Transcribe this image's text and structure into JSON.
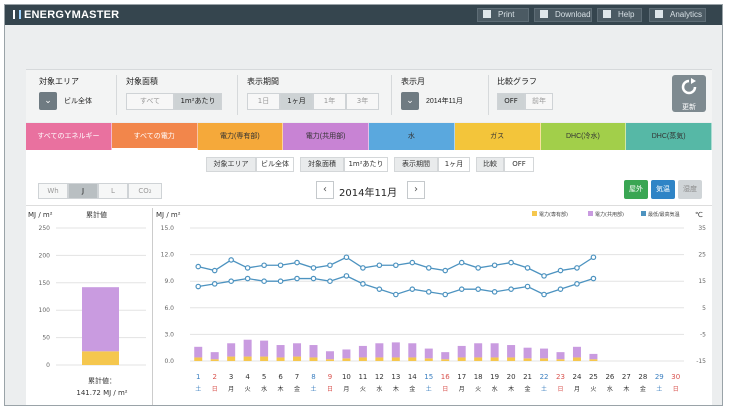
{
  "app": {
    "title": "ENERGYMASTER",
    "menu": [
      {
        "label": "Print",
        "icon": "printer-icon"
      },
      {
        "label": "Download",
        "icon": "download-icon"
      },
      {
        "label": "Help",
        "icon": "help-icon"
      },
      {
        "label": "Analytics",
        "icon": "analytics-icon"
      }
    ]
  },
  "filters": {
    "area": {
      "label": "対象エリア",
      "value": "ビル全体"
    },
    "floor": {
      "label": "対象面積",
      "options": [
        "すべて",
        "1m²あたり"
      ],
      "selected": "1m²あたり"
    },
    "period": {
      "label": "表示期間",
      "options": [
        "1日",
        "1ヶ月",
        "1年",
        "3年"
      ],
      "selected": "1ヶ月"
    },
    "month": {
      "label": "表示月",
      "value": "2014年11月"
    },
    "compare": {
      "label": "比較グラフ",
      "options": [
        "OFF",
        "前年"
      ],
      "selected": "OFF"
    },
    "refresh_label": "更新"
  },
  "tabs": [
    {
      "label": "すべてのエネルギー",
      "color": "#e9719f"
    },
    {
      "label": "すべての電力",
      "color": "#f2864b"
    },
    {
      "label": "電力(専有部)",
      "color": "#f5a93a"
    },
    {
      "label": "電力(共用部)",
      "color": "#c883d4"
    },
    {
      "label": "水",
      "color": "#5aa8de"
    },
    {
      "label": "ガス",
      "color": "#f3c53a"
    },
    {
      "label": "DHC(冷水)",
      "color": "#a2cf4a"
    },
    {
      "label": "DHC(蒸気)",
      "color": "#56b8a6"
    }
  ],
  "summary": {
    "area_key": "対象エリア",
    "area_val": "ビル全体",
    "floor_key": "対象面積",
    "floor_val": "1m²あたり",
    "period_key": "表示期間",
    "period_val": "1ヶ月",
    "compare_key": "比較",
    "compare_val": "OFF"
  },
  "units": {
    "options": [
      "Wh",
      "J",
      "L",
      "CO₂"
    ],
    "selected": "J"
  },
  "nav": {
    "month": "2014年11月",
    "prev": "‹",
    "next": "›"
  },
  "side_buttons": [
    {
      "label": "屋外",
      "color": "#3aa653"
    },
    {
      "label": "気温",
      "color": "#2f84c6"
    },
    {
      "label": "湿度",
      "color": "#d0d5d8"
    }
  ],
  "left_chart": {
    "unit": "MJ / m²",
    "title": "累計値",
    "ticks": [
      "250",
      "200",
      "150",
      "100",
      "50",
      "0"
    ],
    "total_label": "累計値：",
    "total_value": "141.72 MJ / m²"
  },
  "chart_data": {
    "type": "bar",
    "ylabel": "MJ / m²",
    "y2label": "℃",
    "ylim": [
      0,
      15
    ],
    "y2lim": [
      -15,
      35
    ],
    "ticks_left": [
      "15.0",
      "12.0",
      "9.0",
      "6.0",
      "3.0",
      "0.0"
    ],
    "ticks_right": [
      "35",
      "25",
      "15",
      "5",
      "-5",
      "-15"
    ],
    "legend": [
      "電力(専有部)",
      "電力(共用部)",
      "最低/最高気温"
    ],
    "categories": [
      "1",
      "2",
      "3",
      "4",
      "5",
      "6",
      "7",
      "8",
      "9",
      "10",
      "11",
      "12",
      "13",
      "14",
      "15",
      "16",
      "17",
      "18",
      "19",
      "20",
      "21",
      "22",
      "23",
      "24",
      "25",
      "26",
      "27",
      "28",
      "29",
      "30"
    ],
    "day_labels": [
      "土",
      "日",
      "月",
      "火",
      "水",
      "木",
      "金",
      "土",
      "日",
      "月",
      "火",
      "水",
      "木",
      "金",
      "土",
      "日",
      "月",
      "火",
      "水",
      "木",
      "金",
      "土",
      "日",
      "月",
      "火",
      "水",
      "木",
      "金",
      "土",
      "日"
    ],
    "series": [
      {
        "name": "電力(専有部)",
        "color": "#f5c74e",
        "values": [
          0.4,
          0.2,
          0.5,
          0.5,
          0.5,
          0.4,
          0.5,
          0.4,
          0.2,
          0.3,
          0.4,
          0.4,
          0.4,
          0.4,
          0.3,
          0.2,
          0.4,
          0.4,
          0.4,
          0.4,
          0.3,
          0.3,
          0.2,
          0.4,
          0.2,
          0,
          0,
          0,
          0,
          0
        ]
      },
      {
        "name": "電力(共用部)",
        "color": "#c99be0",
        "values": [
          1.2,
          0.8,
          1.5,
          1.9,
          1.8,
          1.4,
          1.5,
          1.4,
          0.9,
          1.0,
          1.3,
          1.6,
          1.7,
          1.6,
          1.1,
          0.8,
          1.3,
          1.6,
          1.6,
          1.4,
          1.2,
          1.1,
          0.8,
          1.2,
          0.6,
          0,
          0,
          0,
          0,
          0
        ]
      },
      {
        "name": "最高気温",
        "color": "#4d93c0",
        "values": [
          20.5,
          19,
          23,
          20,
          21,
          21,
          22,
          20,
          21,
          24,
          20,
          21,
          21,
          22,
          20,
          19,
          22,
          20,
          21,
          22,
          20,
          17,
          19,
          20,
          24
        ]
      },
      {
        "name": "最低気温",
        "color": "#4d93c0",
        "values": [
          13,
          14,
          15,
          16,
          15,
          15,
          16,
          16,
          15,
          17,
          14,
          12,
          10,
          12,
          11,
          10,
          12,
          12,
          11,
          12,
          13,
          10,
          12,
          14,
          16
        ]
      }
    ],
    "left_series": {
      "values": [
        25,
        117
      ],
      "colors": [
        "#f5c74e",
        "#c99be0"
      ],
      "ylim": [
        0,
        250
      ]
    }
  }
}
